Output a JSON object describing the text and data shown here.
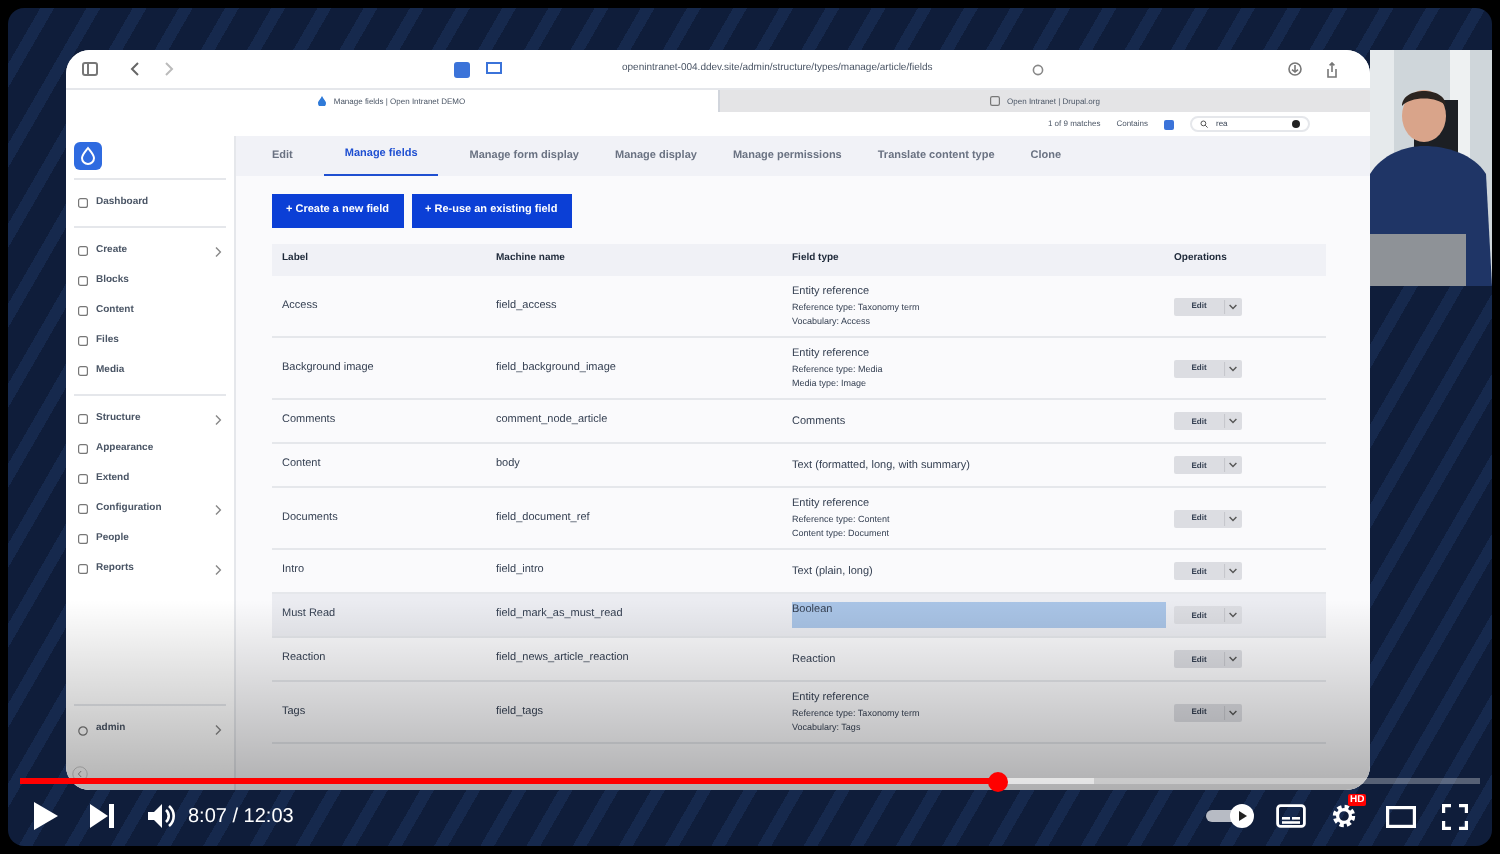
{
  "browser": {
    "url": "openintranet-004.ddev.site/admin/structure/types/manage/article/fields",
    "tabs": [
      {
        "title": "Manage fields | Open Intranet DEMO",
        "selected": true
      },
      {
        "title": "Open Intranet | Drupal.org",
        "selected": false
      }
    ],
    "find_bar": {
      "matches": "1 of 9 matches",
      "mode": "Contains",
      "query": "rea",
      "checked": true
    }
  },
  "sidebar": {
    "sections": [
      {
        "items": [
          {
            "label": "Dashboard",
            "has_submenu": false
          }
        ]
      },
      {
        "items": [
          {
            "label": "Create",
            "has_submenu": true
          },
          {
            "label": "Blocks",
            "has_submenu": false
          },
          {
            "label": "Content",
            "has_submenu": false
          },
          {
            "label": "Files",
            "has_submenu": false
          },
          {
            "label": "Media",
            "has_submenu": false
          }
        ]
      },
      {
        "items": [
          {
            "label": "Structure",
            "has_submenu": true
          },
          {
            "label": "Appearance",
            "has_submenu": false
          },
          {
            "label": "Extend",
            "has_submenu": false
          },
          {
            "label": "Configuration",
            "has_submenu": true
          },
          {
            "label": "People",
            "has_submenu": false
          },
          {
            "label": "Reports",
            "has_submenu": true
          }
        ]
      }
    ],
    "user": {
      "label": "admin",
      "has_submenu": true
    }
  },
  "tabs": [
    {
      "label": "Edit",
      "selected": false
    },
    {
      "label": "Manage fields",
      "selected": true
    },
    {
      "label": "Manage form display",
      "selected": false
    },
    {
      "label": "Manage display",
      "selected": false
    },
    {
      "label": "Manage permissions",
      "selected": false
    },
    {
      "label": "Translate content type",
      "selected": false
    },
    {
      "label": "Clone",
      "selected": false
    }
  ],
  "buttons": [
    "+ Create a new field",
    "+ Re-use an existing field"
  ],
  "table": {
    "columns": [
      "Label",
      "Machine name",
      "Field type",
      "Operations"
    ],
    "rows": [
      {
        "label": "Access",
        "machine_name": "field_access",
        "field_type": [
          "Entity reference",
          "Reference type: Taxonomy term",
          "Vocabulary: Access"
        ],
        "operation": "Edit",
        "highlighted": false
      },
      {
        "label": "Background image",
        "machine_name": "field_background_image",
        "field_type": [
          "Entity reference",
          "Reference type: Media",
          "Media type: Image"
        ],
        "operation": "Edit",
        "highlighted": false
      },
      {
        "label": "Comments",
        "machine_name": "comment_node_article",
        "field_type": [
          "Comments"
        ],
        "operation": "Edit",
        "highlighted": false
      },
      {
        "label": "Content",
        "machine_name": "body",
        "field_type": [
          "Text (formatted, long, with summary)"
        ],
        "operation": "Edit",
        "highlighted": false
      },
      {
        "label": "Documents",
        "machine_name": "field_document_ref",
        "field_type": [
          "Entity reference",
          "Reference type: Content",
          "Content type: Document"
        ],
        "operation": "Edit",
        "highlighted": false
      },
      {
        "label": "Intro",
        "machine_name": "field_intro",
        "field_type": [
          "Text (plain, long)"
        ],
        "operation": "Edit",
        "highlighted": false
      },
      {
        "label": "Must Read",
        "machine_name": "field_mark_as_must_read",
        "field_type": [
          "Boolean"
        ],
        "operation": "Edit",
        "highlighted": true
      },
      {
        "label": "Reaction",
        "machine_name": "field_news_article_reaction",
        "field_type": [
          "Reaction"
        ],
        "operation": "Edit",
        "highlighted": false
      },
      {
        "label": "Tags",
        "machine_name": "field_tags",
        "field_type": [
          "Entity reference",
          "Reference type: Taxonomy term",
          "Vocabulary: Tags"
        ],
        "operation": "Edit",
        "highlighted": false
      }
    ]
  },
  "player": {
    "time": "8:07 / 12:03",
    "level": 0.67,
    "autoplay": true,
    "quality_badge": "HD"
  }
}
